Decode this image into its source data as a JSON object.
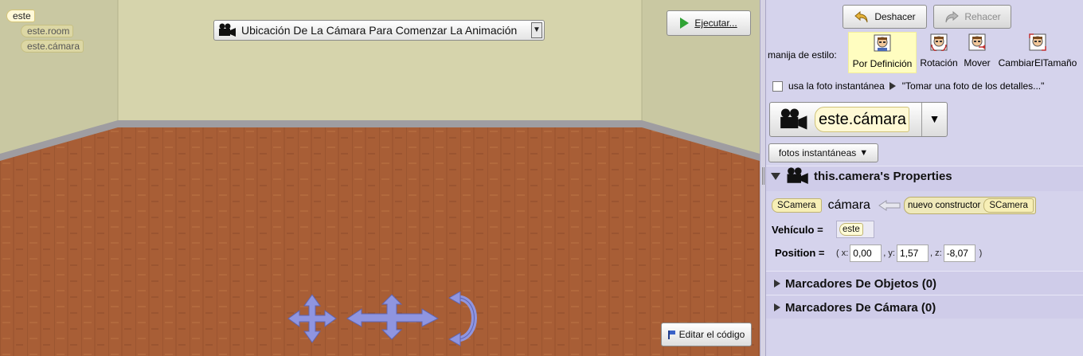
{
  "scene": {
    "tree": {
      "root": "este",
      "children": [
        "este.room",
        "este.cámara"
      ]
    },
    "camera_dropdown": {
      "selected": "Ubicación De La Cámara Para Comenzar La Animación",
      "icon": "movie-camera-icon"
    },
    "run_button": {
      "label": "Ejecutar...",
      "icon": "play-icon"
    },
    "edit_code_button": {
      "label": "Editar el código",
      "icon": "flag-icon"
    },
    "colors": {
      "wall": "#d6d4ac",
      "floor": "#a85e36",
      "baseboard": "#9f9da1"
    }
  },
  "panel": {
    "undo": {
      "label": "Deshacer",
      "icon": "undo-icon"
    },
    "redo": {
      "label": "Rehacer",
      "icon": "redo-icon",
      "enabled": false
    },
    "style": {
      "caption": "manija de estilo:",
      "options": [
        {
          "label": "Por Definición",
          "selected": true
        },
        {
          "label": "Rotación",
          "selected": false
        },
        {
          "label": "Mover",
          "selected": false
        },
        {
          "label": "CambiarElTamaño",
          "selected": false
        }
      ]
    },
    "snapshot_toggle": {
      "label": "usa la foto instantánea",
      "hint": "\"Tomar una foto de los detalles...\"",
      "checked": false
    },
    "object_selector": {
      "value": "este.cámara",
      "icon": "movie-camera-icon"
    },
    "snapshots_button": {
      "label": "fotos instantáneas"
    },
    "properties": {
      "title": "this.camera's Properties",
      "declaration": {
        "type": "SCamera",
        "name": "cámara",
        "constructor_label": "nuevo constructor",
        "constructor_type": "SCamera"
      },
      "vehicle": {
        "label": "Vehículo =",
        "value": "este"
      },
      "position": {
        "label": "Position =",
        "open": "( x:",
        "x": "0,00",
        "y_label": ", y:",
        "y": "1,57",
        "z_label": ", z:",
        "z": "-8,07",
        "close": ")"
      }
    },
    "markers": [
      {
        "label": "Marcadores De Objetos (0)"
      },
      {
        "label": "Marcadores De Cámara (0)"
      }
    ]
  }
}
